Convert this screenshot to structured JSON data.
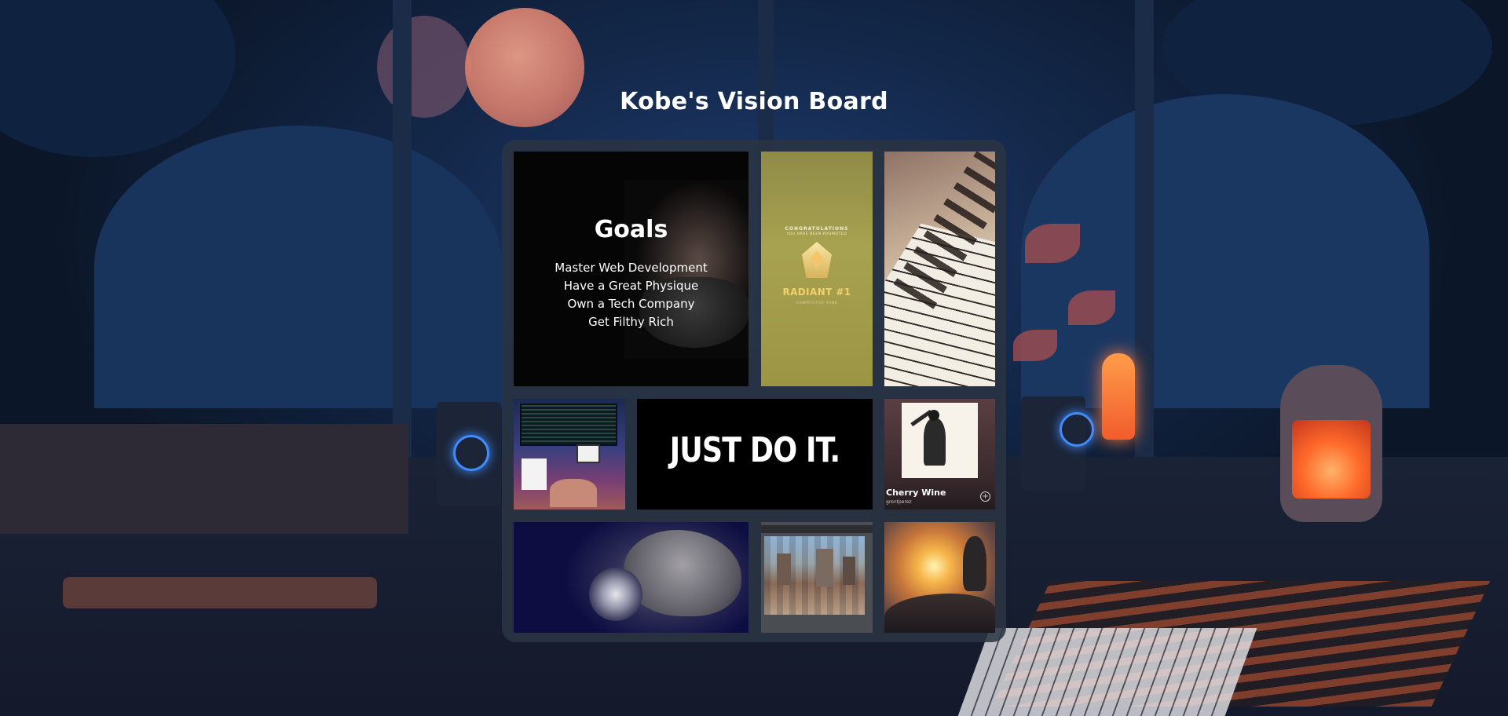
{
  "page": {
    "title": "Kobe's Vision Board"
  },
  "goals": {
    "heading": "Goals",
    "items": [
      "Master Web Development",
      "Have a Great Physique",
      "Own a Tech Company",
      "Get Filthy Rich"
    ]
  },
  "radiant": {
    "congrats": "CONGRATULATIONS",
    "sub": "YOU HAVE BEEN PROMOTED",
    "rank": "RADIANT #1",
    "small": "COMPETITIVE RANK"
  },
  "nike": {
    "slogan": "JUST DO IT."
  },
  "cherry": {
    "song": "Cherry Wine",
    "artist": "grentperez",
    "add_icon": "plus-circle-icon"
  },
  "colors": {
    "board_bg": "#2a3442",
    "title_text": "#ffffff",
    "radiant_gold": "#f4d06a"
  }
}
